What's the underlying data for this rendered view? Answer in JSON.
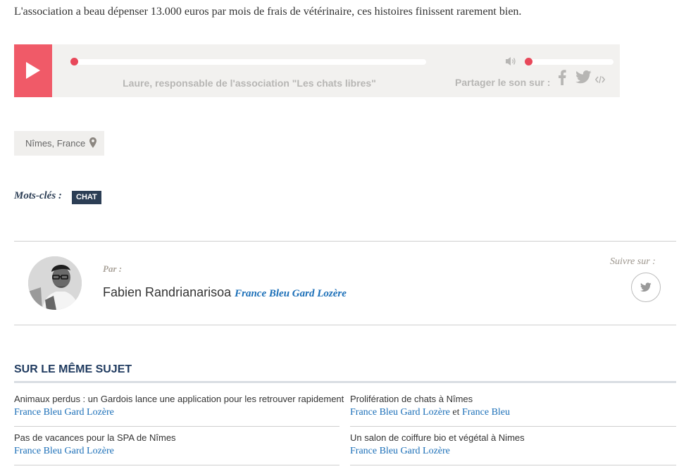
{
  "intro": "L'association a beau dépenser 13.000 euros par mois de frais de vétérinaire, ces histoires finissent rarement bien.",
  "player": {
    "caption": "Laure, responsable de l'association \"Les chats libres\"",
    "share_label": "Partager le son sur :",
    "progress": 0,
    "volume": 0,
    "accent": "#f05a68",
    "icons": [
      "play-icon",
      "volume-icon",
      "facebook-icon",
      "twitter-icon",
      "embed-icon"
    ]
  },
  "location": {
    "label": "Nîmes, France",
    "icon": "map-pin-icon"
  },
  "tags": {
    "label": "Mots-clés :",
    "items": [
      "CHAT"
    ]
  },
  "author": {
    "par_label": "Par :",
    "name": "Fabien Randrianarisoa",
    "station": "France Bleu Gard Lozère",
    "follow_label": "Suivre sur :",
    "follow_icon": "twitter-icon"
  },
  "related": {
    "title": "SUR LE MÊME SUJET",
    "articles": [
      {
        "title": "Animaux perdus : un Gardois lance une application pour les retrouver rapidement",
        "sources": [
          "France Bleu Gard Lozère"
        ],
        "joiner": ""
      },
      {
        "title": "Prolifération de chats à Nîmes",
        "sources": [
          "France Bleu Gard Lozère",
          "France Bleu"
        ],
        "joiner": "et"
      },
      {
        "title": "Pas de vacances pour la SPA de Nîmes",
        "sources": [
          "France Bleu Gard Lozère"
        ],
        "joiner": ""
      },
      {
        "title": "Un salon de coiffure bio et végétal à Nimes",
        "sources": [
          "France Bleu Gard Lozère"
        ],
        "joiner": ""
      }
    ]
  }
}
